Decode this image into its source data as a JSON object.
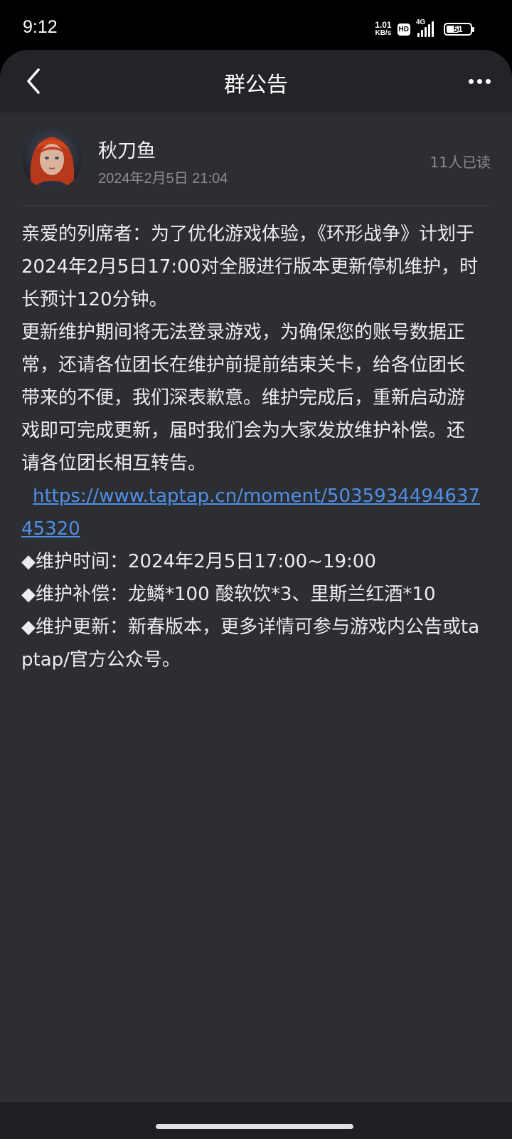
{
  "status_bar": {
    "time": "9:12",
    "net_speed_value": "1.01",
    "net_speed_unit": "KB/s",
    "hd_badge": "HD",
    "network_type": "4G",
    "battery_level": "51"
  },
  "nav": {
    "title": "群公告",
    "back_icon": "chevron-left-icon",
    "more_icon": "more-horizontal-icon"
  },
  "announcement": {
    "author": "秋刀鱼",
    "timestamp": "2024年2月5日 21:04",
    "read_count": "11人已读",
    "paragraph_1": "亲爱的列席者：为了优化游戏体验，《环形战争》计划于2024年2月5日17:00对全服进行版本更新停机维护，时长预计120分钟。",
    "paragraph_2": "更新维护期间将无法登录游戏，为确保您的账号数据正常，还请各位团长在维护前提前结束关卡，给各位团长带来的不便，我们深表歉意。维护完成后，重新启动游戏即可完成更新，届时我们会为大家发放维护补偿。还请各位团长相互转告。",
    "link": "https://www.taptap.cn/moment/503593449463745320",
    "item_time": "◆维护时间：2024年2月5日17:00~19:00",
    "item_compensation": "◆维护补偿：龙鳞*100 酸软饮*3、里斯兰红酒*10",
    "item_update": "◆维护更新：新春版本，更多详情可参与游戏内公告或taptap/官方公众号。"
  },
  "colors": {
    "background": "#2d2e32",
    "nav_background": "#232427",
    "link": "#4f8fe6",
    "muted_text": "#8a8b90"
  }
}
